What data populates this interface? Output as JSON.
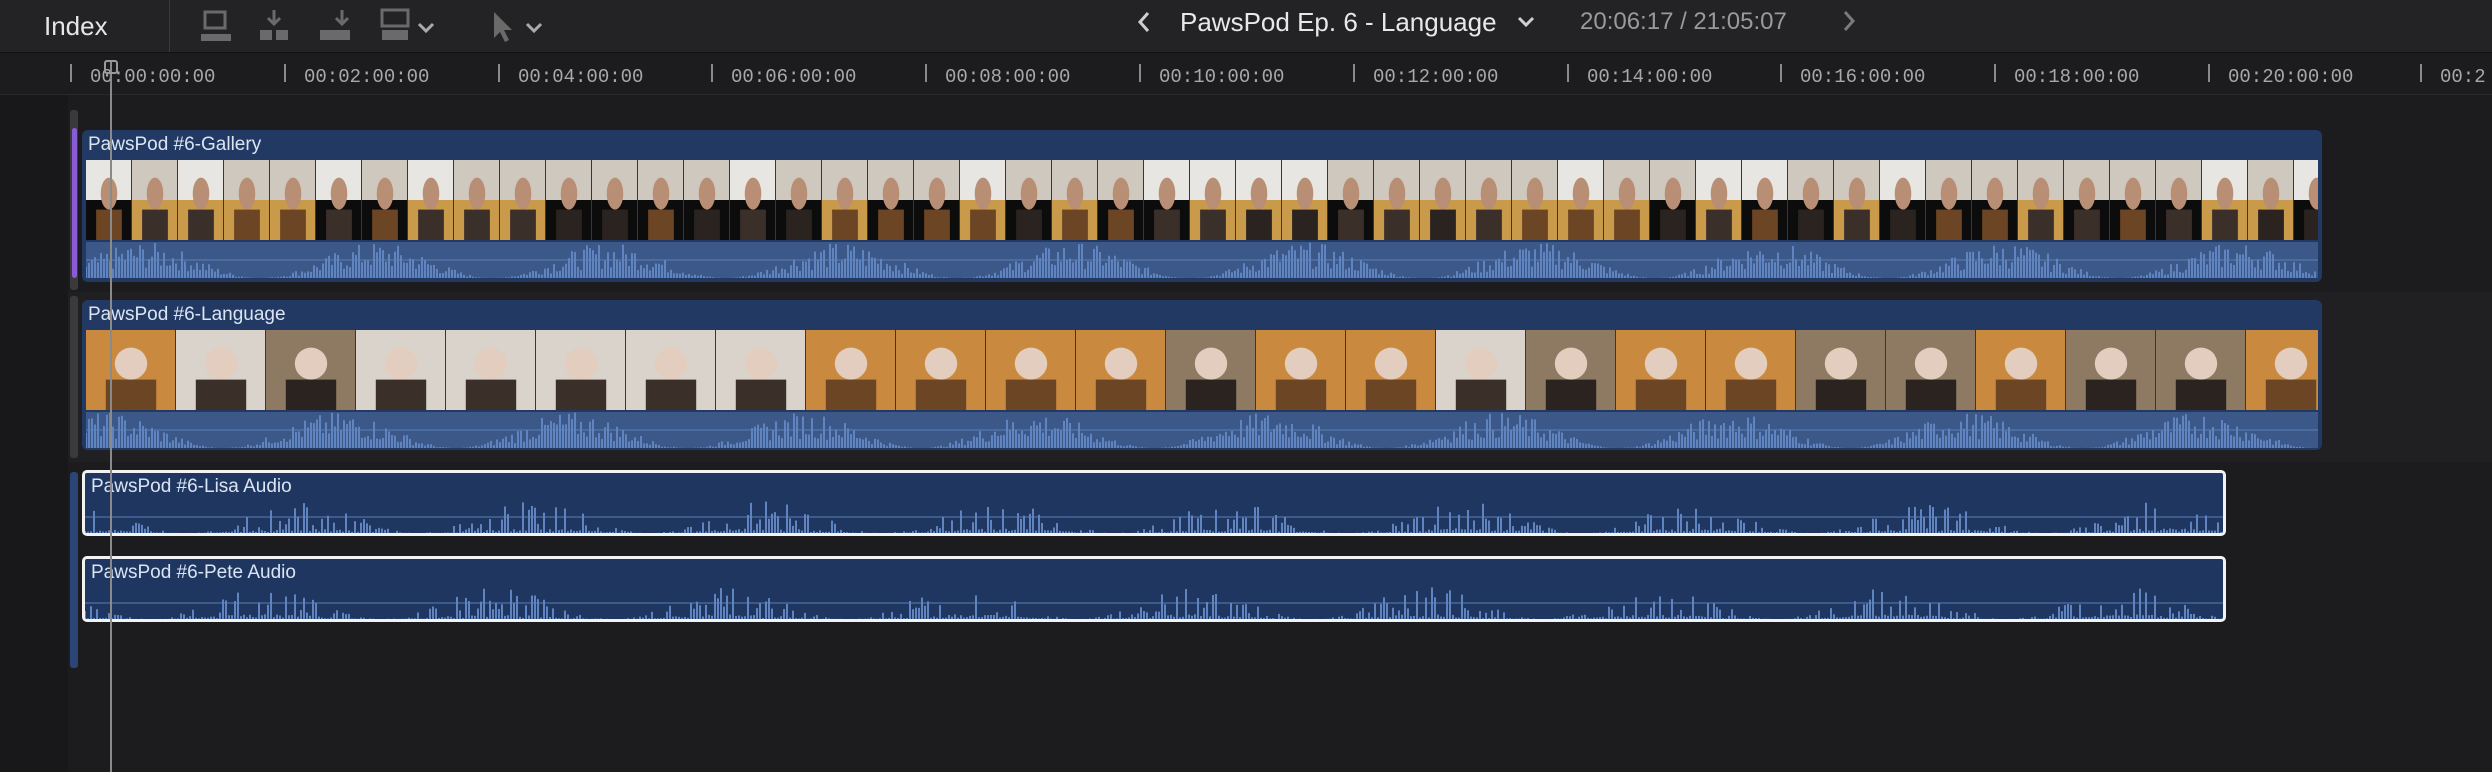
{
  "toolbar": {
    "index_label": "Index",
    "project_title": "PawsPod Ep. 6 - Language",
    "timecode": "20:06:17 / 21:05:07"
  },
  "ruler": {
    "labels": [
      "00:00:00:00",
      "00:02:00:00",
      "00:04:00:00",
      "00:06:00:00",
      "00:08:00:00",
      "00:10:00:00",
      "00:12:00:00",
      "00:14:00:00",
      "00:16:00:00",
      "00:18:00:00",
      "00:20:00:00",
      "00:2"
    ]
  },
  "clips": {
    "gallery": "PawsPod #6-Gallery",
    "language": "PawsPod #6-Language",
    "lisa": "PawsPod #6-Lisa Audio",
    "pete": "PawsPod #6-Pete Audio"
  },
  "colors": {
    "clip_fill": "#223a63",
    "waveform": "#5a7fb8",
    "selection_border": "#f2f2f2",
    "accent_purple": "#8a5bd6"
  }
}
